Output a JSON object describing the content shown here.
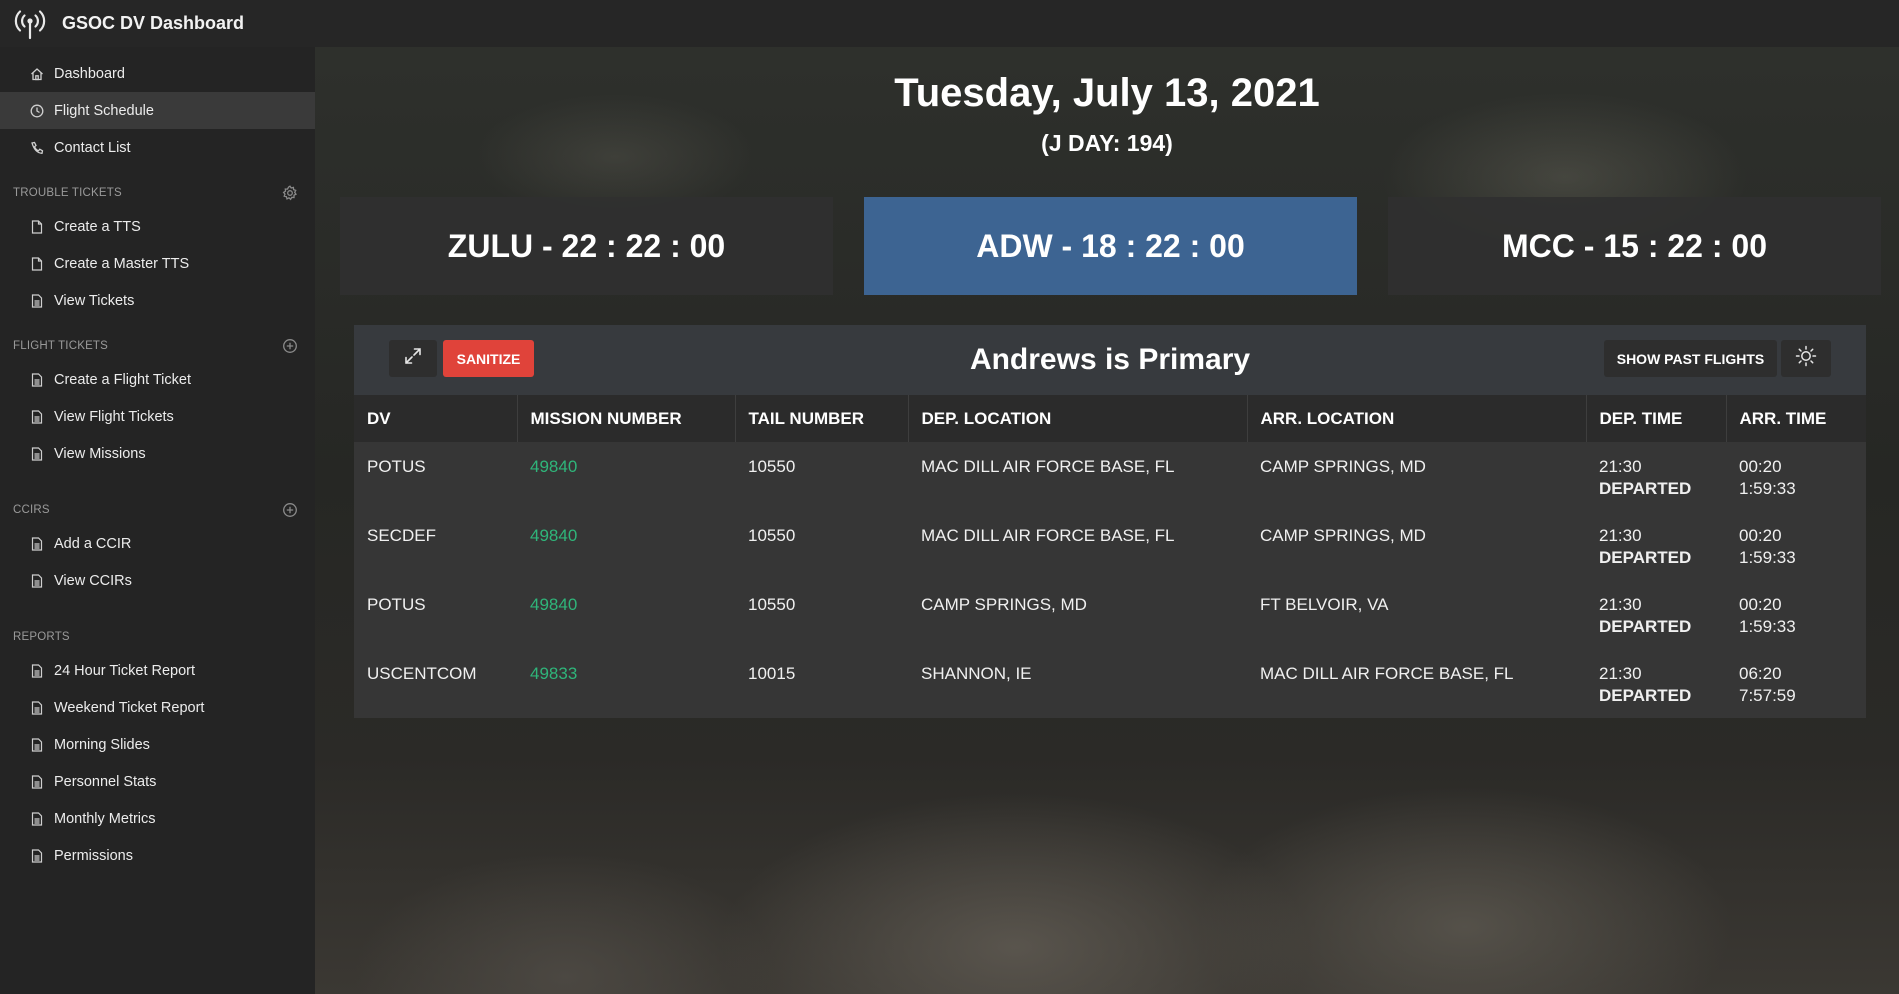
{
  "app": {
    "title": "GSOC DV Dashboard"
  },
  "sidebar": {
    "top_items": [
      {
        "label": "Dashboard",
        "icon": "home-icon"
      },
      {
        "label": "Flight Schedule",
        "icon": "clock-icon",
        "active": true
      },
      {
        "label": "Contact List",
        "icon": "phone-icon"
      }
    ],
    "sections": [
      {
        "heading": "TROUBLE TICKETS",
        "action_icon": "gear-icon",
        "items": [
          "Create a TTS",
          "Create a Master TTS",
          "View Tickets"
        ]
      },
      {
        "heading": "FLIGHT TICKETS",
        "action_icon": "plus-circle-icon",
        "items": [
          "Create a Flight Ticket",
          "View Flight Tickets",
          "View Missions"
        ]
      },
      {
        "heading": "CCIRS",
        "action_icon": "plus-circle-icon",
        "items": [
          "Add a CCIR",
          "View CCIRs"
        ]
      },
      {
        "heading": "REPORTS",
        "action_icon": "",
        "items": [
          "24 Hour Ticket Report",
          "Weekend Ticket Report",
          "Morning Slides",
          "Personnel Stats",
          "Monthly Metrics",
          "Permissions"
        ]
      }
    ]
  },
  "main": {
    "date": "Tuesday, July 13, 2021",
    "jday": "(J DAY: 194)",
    "clocks": {
      "zulu": "ZULU - 22 : 22 : 00",
      "adw": "ADW - 18 : 22 : 00",
      "mcc": "MCC - 15 : 22 : 00"
    },
    "panel": {
      "title": "Andrews is Primary",
      "sanitize_label": "SANITIZE",
      "past_flights_label": "SHOW PAST FLIGHTS"
    },
    "table": {
      "headers": [
        "DV",
        "MISSION NUMBER",
        "TAIL NUMBER",
        "DEP. LOCATION",
        "ARR. LOCATION",
        "DEP. TIME",
        "ARR. TIME"
      ],
      "rows": [
        {
          "dv": "POTUS",
          "mission": "49840",
          "tail": "10550",
          "dep_loc": "MAC DILL AIR FORCE BASE, FL",
          "arr_loc": "CAMP SPRINGS, MD",
          "dep_time": "21:30",
          "dep_status": "DEPARTED",
          "arr_time": "00:20",
          "arr_eta": "1:59:33"
        },
        {
          "dv": "SECDEF",
          "mission": "49840",
          "tail": "10550",
          "dep_loc": "MAC DILL AIR FORCE BASE, FL",
          "arr_loc": "CAMP SPRINGS, MD",
          "dep_time": "21:30",
          "dep_status": "DEPARTED",
          "arr_time": "00:20",
          "arr_eta": "1:59:33"
        },
        {
          "dv": "POTUS",
          "mission": "49840",
          "tail": "10550",
          "dep_loc": "CAMP SPRINGS, MD",
          "arr_loc": "FT BELVOIR, VA",
          "dep_time": "21:30",
          "dep_status": "DEPARTED",
          "arr_time": "00:20",
          "arr_eta": "1:59:33"
        },
        {
          "dv": "USCENTCOM",
          "mission": "49833",
          "tail": "10015",
          "dep_loc": "SHANNON, IE",
          "arr_loc": "MAC DILL AIR FORCE BASE, FL",
          "dep_time": "21:30",
          "dep_status": "DEPARTED",
          "arr_time": "06:20",
          "arr_eta": "7:57:59"
        }
      ]
    }
  },
  "colors": {
    "accent_adw": "#3d6492",
    "sanitize": "#e0433a",
    "mission_link": "#2fb57a"
  }
}
